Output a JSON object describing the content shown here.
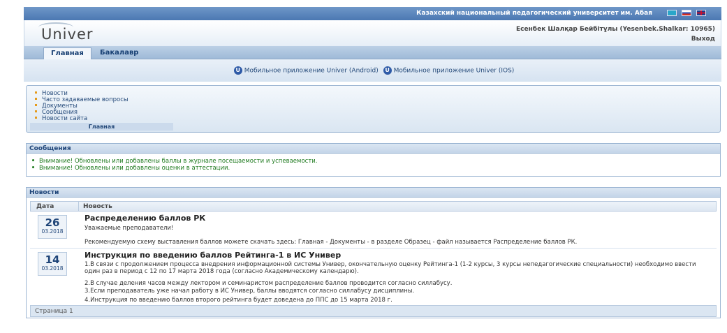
{
  "topbar": {
    "university": "Казахский национальный педагогический университет им. Абая"
  },
  "header": {
    "logo": "Univer",
    "user": "Есенбек Шалқар Бейбітұлы (Yesenbek.Shalkar: 10965)",
    "logout": "Выход"
  },
  "nav": {
    "tabs": [
      {
        "label": "Главная"
      },
      {
        "label": "Бакалавр"
      }
    ]
  },
  "mobile": {
    "android": "Мобильное приложение Univer (Android)",
    "ios": "Мобильное приложение Univer (IOS)"
  },
  "menu": {
    "items": [
      "Новости",
      "Часто задаваемые вопросы",
      "Документы",
      "Сообщения",
      "Новости сайта"
    ],
    "caption": "Главная"
  },
  "messages": {
    "title": "Сообщения",
    "items": [
      "Внимание! Обновлены или добавлены баллы в журнале посещаемости и успеваемости.",
      "Внимание! Обновлены или добавлены оценки в аттестации."
    ]
  },
  "news": {
    "title": "Новости",
    "col_date": "Дата",
    "col_news": "Новость",
    "items": [
      {
        "day": "26",
        "monthyear": "03.2018",
        "title": "Распределению баллов РК",
        "p1": "Уважаемые преподаватели!",
        "p2": "Рекомендуемую схему выставления баллов можете скачать здесь: Главная - Документы - в разделе Образец - файл называется Распределение баллов РК."
      },
      {
        "day": "14",
        "monthyear": "03.2018",
        "title": "Инструкция по введению баллов Рейтинга-1 в ИС Универ",
        "p1": "1.В связи с продолжением процесса внедрения информационной системы Универ, окончательную оценку Рейтинга-1 (1-2 курсы, 3 курсы непедагогические специальности) необходимо ввести один раз в период с 12 по 17 марта 2018 года (согласно Академическому календарю).",
        "p2": "2.В случае деления часов между лектором и семинаристом распределение баллов проводится согласно силлабусу.",
        "p3": "3.Если преподаватель уже начал работу в ИС Универ, баллы вводятся согласно силлабусу дисциплины.",
        "p4": "4.Инструкция по введению баллов второго рейтинга будет доведена до ППС до 15 марта 2018 г."
      }
    ],
    "pager": "Страница 1"
  }
}
